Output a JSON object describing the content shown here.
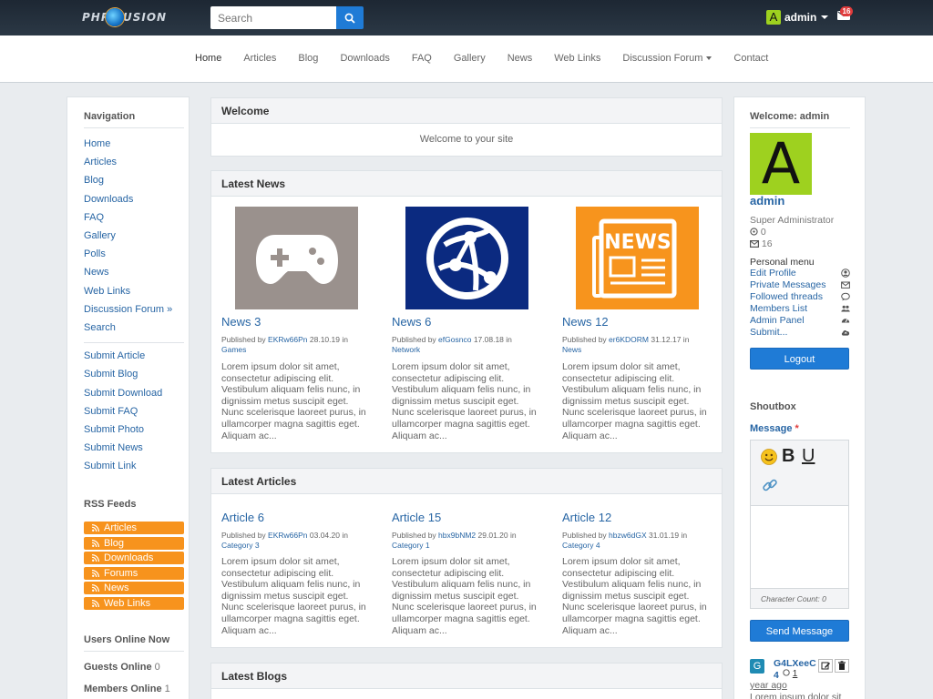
{
  "header": {
    "logo_text": "PHP FUSION",
    "search_placeholder": "Search",
    "user_initial": "A",
    "user_name": "admin",
    "message_count": "16"
  },
  "nav": {
    "items": [
      "Home",
      "Articles",
      "Blog",
      "Downloads",
      "FAQ",
      "Gallery",
      "News",
      "Web Links",
      "Discussion Forum",
      "Contact"
    ]
  },
  "left": {
    "navigation_title": "Navigation",
    "links": [
      "Home",
      "Articles",
      "Blog",
      "Downloads",
      "FAQ",
      "Gallery",
      "Polls",
      "News",
      "Web Links",
      "Discussion Forum »",
      "Search"
    ],
    "submit_links": [
      "Submit Article",
      "Submit Blog",
      "Submit Download",
      "Submit FAQ",
      "Submit Photo",
      "Submit News",
      "Submit Link"
    ],
    "rss_title": "RSS Feeds",
    "rss": [
      "Articles",
      "Blog",
      "Downloads",
      "Forums",
      "News",
      "Web Links"
    ],
    "online_title": "Users Online Now",
    "guests_label": "Guests Online",
    "guests_count": "0",
    "members_label": "Members Online",
    "members_count": "1"
  },
  "welcome": {
    "title": "Welcome",
    "text": "Welcome to your site"
  },
  "news": {
    "title": "Latest News",
    "items": [
      {
        "title": "News 3",
        "published": "Published by",
        "author": "EKRw66Pn",
        "date": "28.10.19 in",
        "category": "Games",
        "icon": "gamepad-icon",
        "color": "#9a918d",
        "body": "Lorem ipsum dolor sit amet, consectetur adipiscing elit. Vestibulum aliquam felis nunc, in dignissim metus suscipit eget. Nunc scelerisque laoreet purus, in ullamcorper magna sagittis eget. Aliquam ac..."
      },
      {
        "title": "News 6",
        "published": "Published by",
        "author": "efGosnco",
        "date": "17.08.18 in",
        "category": "Network",
        "icon": "globe-network-icon",
        "color": "#0b2a80",
        "body": "Lorem ipsum dolor sit amet, consectetur adipiscing elit. Vestibulum aliquam felis nunc, in dignissim metus suscipit eget. Nunc scelerisque laoreet purus, in ullamcorper magna sagittis eget. Aliquam ac..."
      },
      {
        "title": "News 12",
        "published": "Published by",
        "author": "er6KDORM",
        "date": "31.12.17 in",
        "category": "News",
        "icon": "newspaper-icon",
        "color": "#f7941d",
        "body": "Lorem ipsum dolor sit amet, consectetur adipiscing elit. Vestibulum aliquam felis nunc, in dignissim metus suscipit eget. Nunc scelerisque laoreet purus, in ullamcorper magna sagittis eget. Aliquam ac..."
      }
    ]
  },
  "articles": {
    "title": "Latest Articles",
    "items": [
      {
        "title": "Article 6",
        "published": "Published by",
        "author": "EKRw66Pn",
        "date": "03.04.20 in",
        "category": "Category 3",
        "body": "Lorem ipsum dolor sit amet, consectetur adipiscing elit. Vestibulum aliquam felis nunc, in dignissim metus suscipit eget. Nunc scelerisque laoreet purus, in ullamcorper magna sagittis eget. Aliquam ac..."
      },
      {
        "title": "Article 15",
        "published": "Published by",
        "author": "hbx9bNM2",
        "date": "29.01.20 in",
        "category": "Category 1",
        "body": "Lorem ipsum dolor sit amet, consectetur adipiscing elit. Vestibulum aliquam felis nunc, in dignissim metus suscipit eget. Nunc scelerisque laoreet purus, in ullamcorper magna sagittis eget. Aliquam ac..."
      },
      {
        "title": "Article 12",
        "published": "Published by",
        "author": "hbzw6dGX",
        "date": "31.01.19 in",
        "category": "Category 4",
        "body": "Lorem ipsum dolor sit amet, consectetur adipiscing elit. Vestibulum aliquam felis nunc, in dignissim metus suscipit eget. Nunc scelerisque laoreet purus, in ullamcorper magna sagittis eget. Aliquam ac..."
      }
    ]
  },
  "blogs": {
    "title": "Latest Blogs"
  },
  "right": {
    "welcome_title": "Welcome: admin",
    "avatar_letter": "A",
    "name": "admin",
    "role": "Super Administrator",
    "points": "0",
    "messages": "16",
    "menu_title": "Personal menu",
    "menu": [
      "Edit Profile",
      "Private Messages",
      "Followed threads",
      "Members List",
      "Admin Panel",
      "Submit..."
    ],
    "logout": "Logout",
    "shoutbox_title": "Shoutbox",
    "message_label": "Message",
    "required_mark": "*",
    "bold": "B",
    "underline": "U",
    "char_count": "Character Count: 0",
    "send": "Send Message",
    "shout_initial": "G",
    "shout_user": "G4LXeeC4",
    "shout_count": "1",
    "shout_time": "year ago",
    "shout_text": "Lorem ipsum dolor sit"
  },
  "colors": {
    "accent": "#1f7bd6",
    "link": "#2765a4",
    "rss": "#f7931d",
    "avatar": "#9ed11f"
  }
}
